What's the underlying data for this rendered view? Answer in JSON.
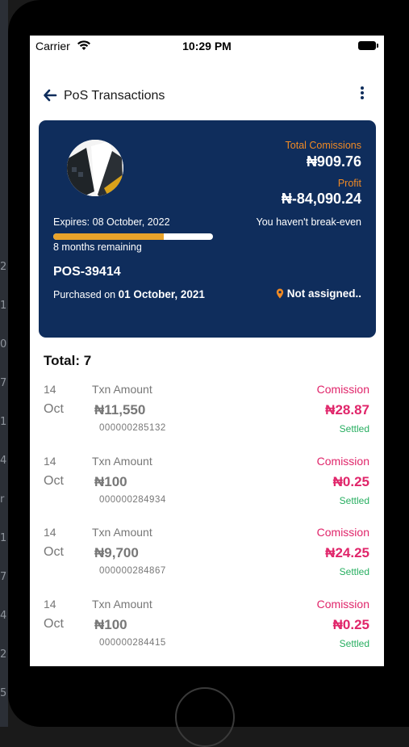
{
  "left_strip_glyphs": [
    "2",
    "1",
    "0",
    "7",
    "1",
    "4",
    "r",
    "1",
    "7",
    "4",
    "2",
    "5"
  ],
  "status_bar": {
    "carrier": "Carrier",
    "time": "10:29 PM"
  },
  "nav": {
    "title": "PoS Transactions",
    "back_icon": "arrow-left-icon",
    "menu_icon": "more-vertical-icon"
  },
  "summary_card": {
    "total_commissions_label": "Total Comissions",
    "total_commissions_value": "₦909.76",
    "profit_label": "Profit",
    "profit_value": "₦-84,090.24",
    "break_even_text": "You haven't break-even",
    "expires_text": "Expires: 08 October, 2022",
    "remaining_text": "8 months remaining",
    "progress_fraction": 0.69,
    "pos_id": "POS-39414",
    "purchased_prefix": "Purchased on",
    "purchased_date": "01 October, 2021",
    "location_text": "Not assigned..",
    "colors": {
      "card_bg": "#0f2d5c",
      "accent_orange": "#f08a24",
      "progress_fill": "#e9a32a"
    }
  },
  "total_label": "Total: 7",
  "transactions": [
    {
      "day": "14",
      "month": "Oct",
      "label": "Txn Amount",
      "amount": "₦11,550",
      "ref": "000000285132",
      "commission_label": "Comission",
      "commission_value": "₦28.87",
      "status": "Settled"
    },
    {
      "day": "14",
      "month": "Oct",
      "label": "Txn Amount",
      "amount": "₦100",
      "ref": "000000284934",
      "commission_label": "Comission",
      "commission_value": "₦0.25",
      "status": "Settled"
    },
    {
      "day": "14",
      "month": "Oct",
      "label": "Txn Amount",
      "amount": "₦9,700",
      "ref": "000000284867",
      "commission_label": "Comission",
      "commission_value": "₦24.25",
      "status": "Settled"
    },
    {
      "day": "14",
      "month": "Oct",
      "label": "Txn Amount",
      "amount": "₦100",
      "ref": "000000284415",
      "commission_label": "Comission",
      "commission_value": "₦0.25",
      "status": "Settled"
    }
  ]
}
